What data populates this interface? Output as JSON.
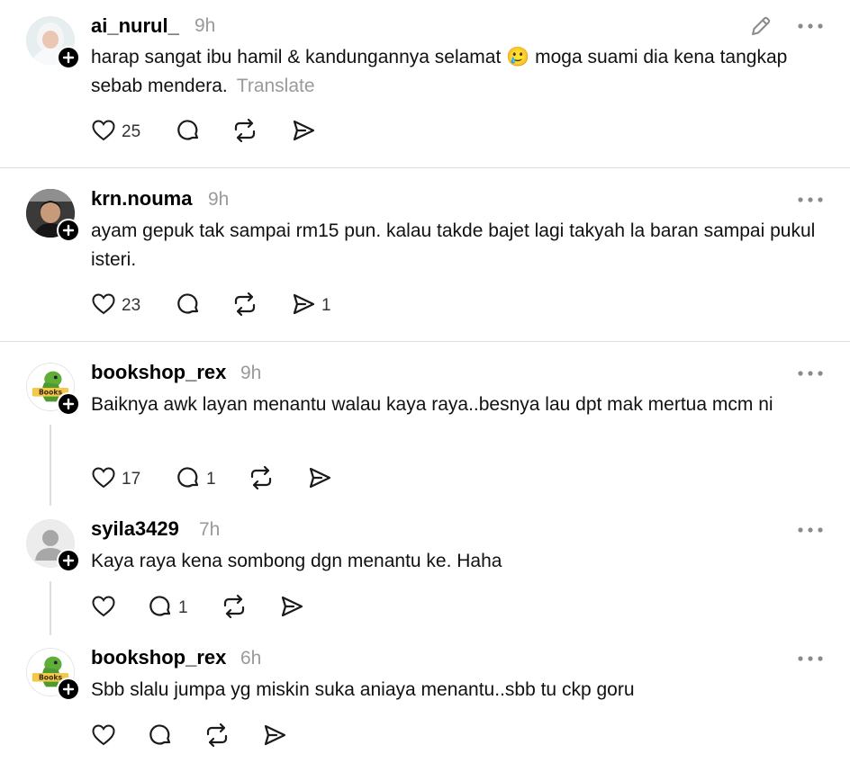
{
  "posts": [
    {
      "username": "ai_nurul_",
      "time": "9h",
      "text": "harap sangat ibu hamil & kandungannya selamat 🥲 moga suami dia kena tangkap sebab mendera.",
      "translate": "Translate",
      "likes": "25",
      "replies": "",
      "reposts": "",
      "shares": ""
    },
    {
      "username": "krn.nouma",
      "time": "9h",
      "text": "ayam gepuk tak sampai rm15 pun. kalau takde bajet lagi takyah la baran sampai pukul isteri.",
      "likes": "23",
      "replies": "",
      "reposts": "",
      "shares": "1"
    },
    {
      "username": "bookshop_rex",
      "time": "9h",
      "text": "Baiknya awk layan menantu walau kaya raya..besnya lau dpt mak mertua mcm ni",
      "likes": "17",
      "replies": "1",
      "reposts": "",
      "shares": ""
    },
    {
      "username": "syila3429",
      "time": "7h",
      "text": "Kaya raya kena sombong dgn menantu ke. Haha",
      "likes": "",
      "replies": "1",
      "reposts": "",
      "shares": ""
    },
    {
      "username": "bookshop_rex",
      "time": "6h",
      "text": "Sbb slalu jumpa yg miskin suka aniaya menantu..sbb tu ckp goru",
      "likes": "",
      "replies": "",
      "reposts": "",
      "shares": ""
    }
  ],
  "icons": {
    "like": "heart-icon",
    "reply": "comment-icon",
    "repost": "repost-icon",
    "share": "send-icon",
    "more": "more-dots-icon",
    "edit": "pencil-icon",
    "follow": "plus-icon"
  },
  "colors": {
    "muted": "#9a9a9a",
    "divider": "#dedede",
    "thread": "#dcdcdc"
  }
}
